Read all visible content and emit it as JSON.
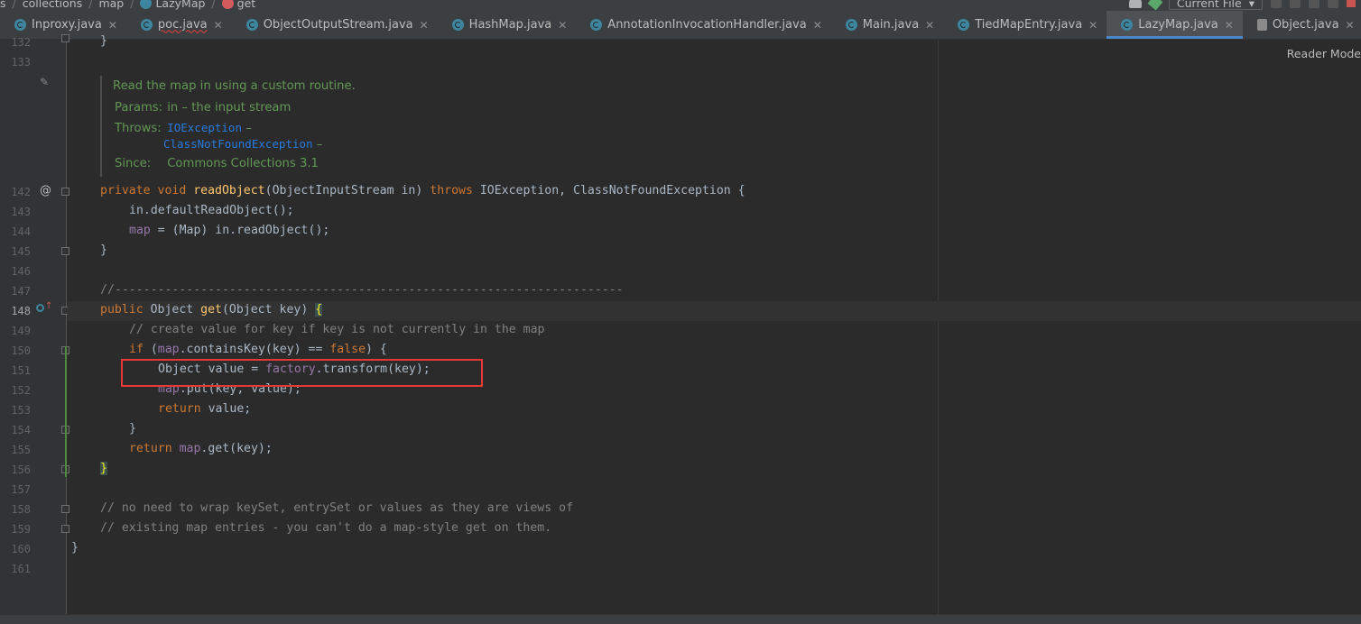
{
  "breadcrumb": {
    "items": [
      "s",
      "collections",
      "map",
      "LazyMap",
      "get"
    ]
  },
  "toolbar": {
    "run_config": "Current File"
  },
  "tabs": [
    {
      "label": "Inproxy.java",
      "active": false,
      "error": false
    },
    {
      "label": "poc.java",
      "active": false,
      "error": true
    },
    {
      "label": "ObjectOutputStream.java",
      "active": false,
      "error": false
    },
    {
      "label": "HashMap.java",
      "active": false,
      "error": false
    },
    {
      "label": "AnnotationInvocationHandler.java",
      "active": false,
      "error": false
    },
    {
      "label": "Main.java",
      "active": false,
      "error": false
    },
    {
      "label": "TiedMapEntry.java",
      "active": false,
      "error": false
    },
    {
      "label": "LazyMap.java",
      "active": true,
      "error": false
    },
    {
      "label": "Object.java",
      "active": false,
      "error": false
    }
  ],
  "editor": {
    "reader_mode_label": "Reader Mode",
    "left_edge_char": "ct",
    "doc": {
      "summary": "Read the map in using a custom routine.",
      "params_label": "Params:",
      "params_value": "in – the input stream",
      "throws_label": "Throws:",
      "throws_1": "IOException",
      "throws_2": "ClassNotFoundException",
      "throws_dash": " –",
      "since_label": "Since:",
      "since_value": "Commons Collections 3.1"
    },
    "line_numbers": [
      "132",
      "133",
      "142",
      "143",
      "144",
      "145",
      "146",
      "147",
      "148",
      "149",
      "150",
      "151",
      "152",
      "153",
      "154",
      "155",
      "156",
      "157",
      "158",
      "159",
      "160",
      "161"
    ],
    "code": {
      "l132": "}",
      "l142_kw1": "private void ",
      "l142_fn": "readObject",
      "l142_rest1": "(ObjectInputStream in) ",
      "l142_kw2": "throws ",
      "l142_rest2": "IOException, ClassNotFoundException {",
      "l143": "in.defaultReadObject();",
      "l144_fld": "map",
      "l144_rest": " = (Map) in.readObject();",
      "l145": "}",
      "l147": "//-----------------------------------------------------------------------",
      "l148_kw": "public ",
      "l148_rest1": "Object ",
      "l148_fn": "get",
      "l148_rest2": "(Object key) ",
      "l148_brace": "{",
      "l149": "// create value for key if key is not currently in the map",
      "l150_kw": "if ",
      "l150_p1": "(",
      "l150_fld": "map",
      "l150_p2": ".containsKey(key) == ",
      "l150_kw2": "false",
      "l150_p3": ") {",
      "l151_p1": "Object value = ",
      "l151_fld": "factory",
      "l151_p2": ".transform(key);",
      "l152_fld": "map",
      "l152_rest": ".put(key, value);",
      "l153_kw": "return ",
      "l153_rest": "value;",
      "l154": "}",
      "l155_kw": "return ",
      "l155_fld": "map",
      "l155_rest": ".get(key);",
      "l156": "}",
      "l158": "// no need to wrap keySet, entrySet or values as they are views of",
      "l159": "// existing map entries - you can't do a map-style get on them.",
      "l160": "}"
    }
  }
}
